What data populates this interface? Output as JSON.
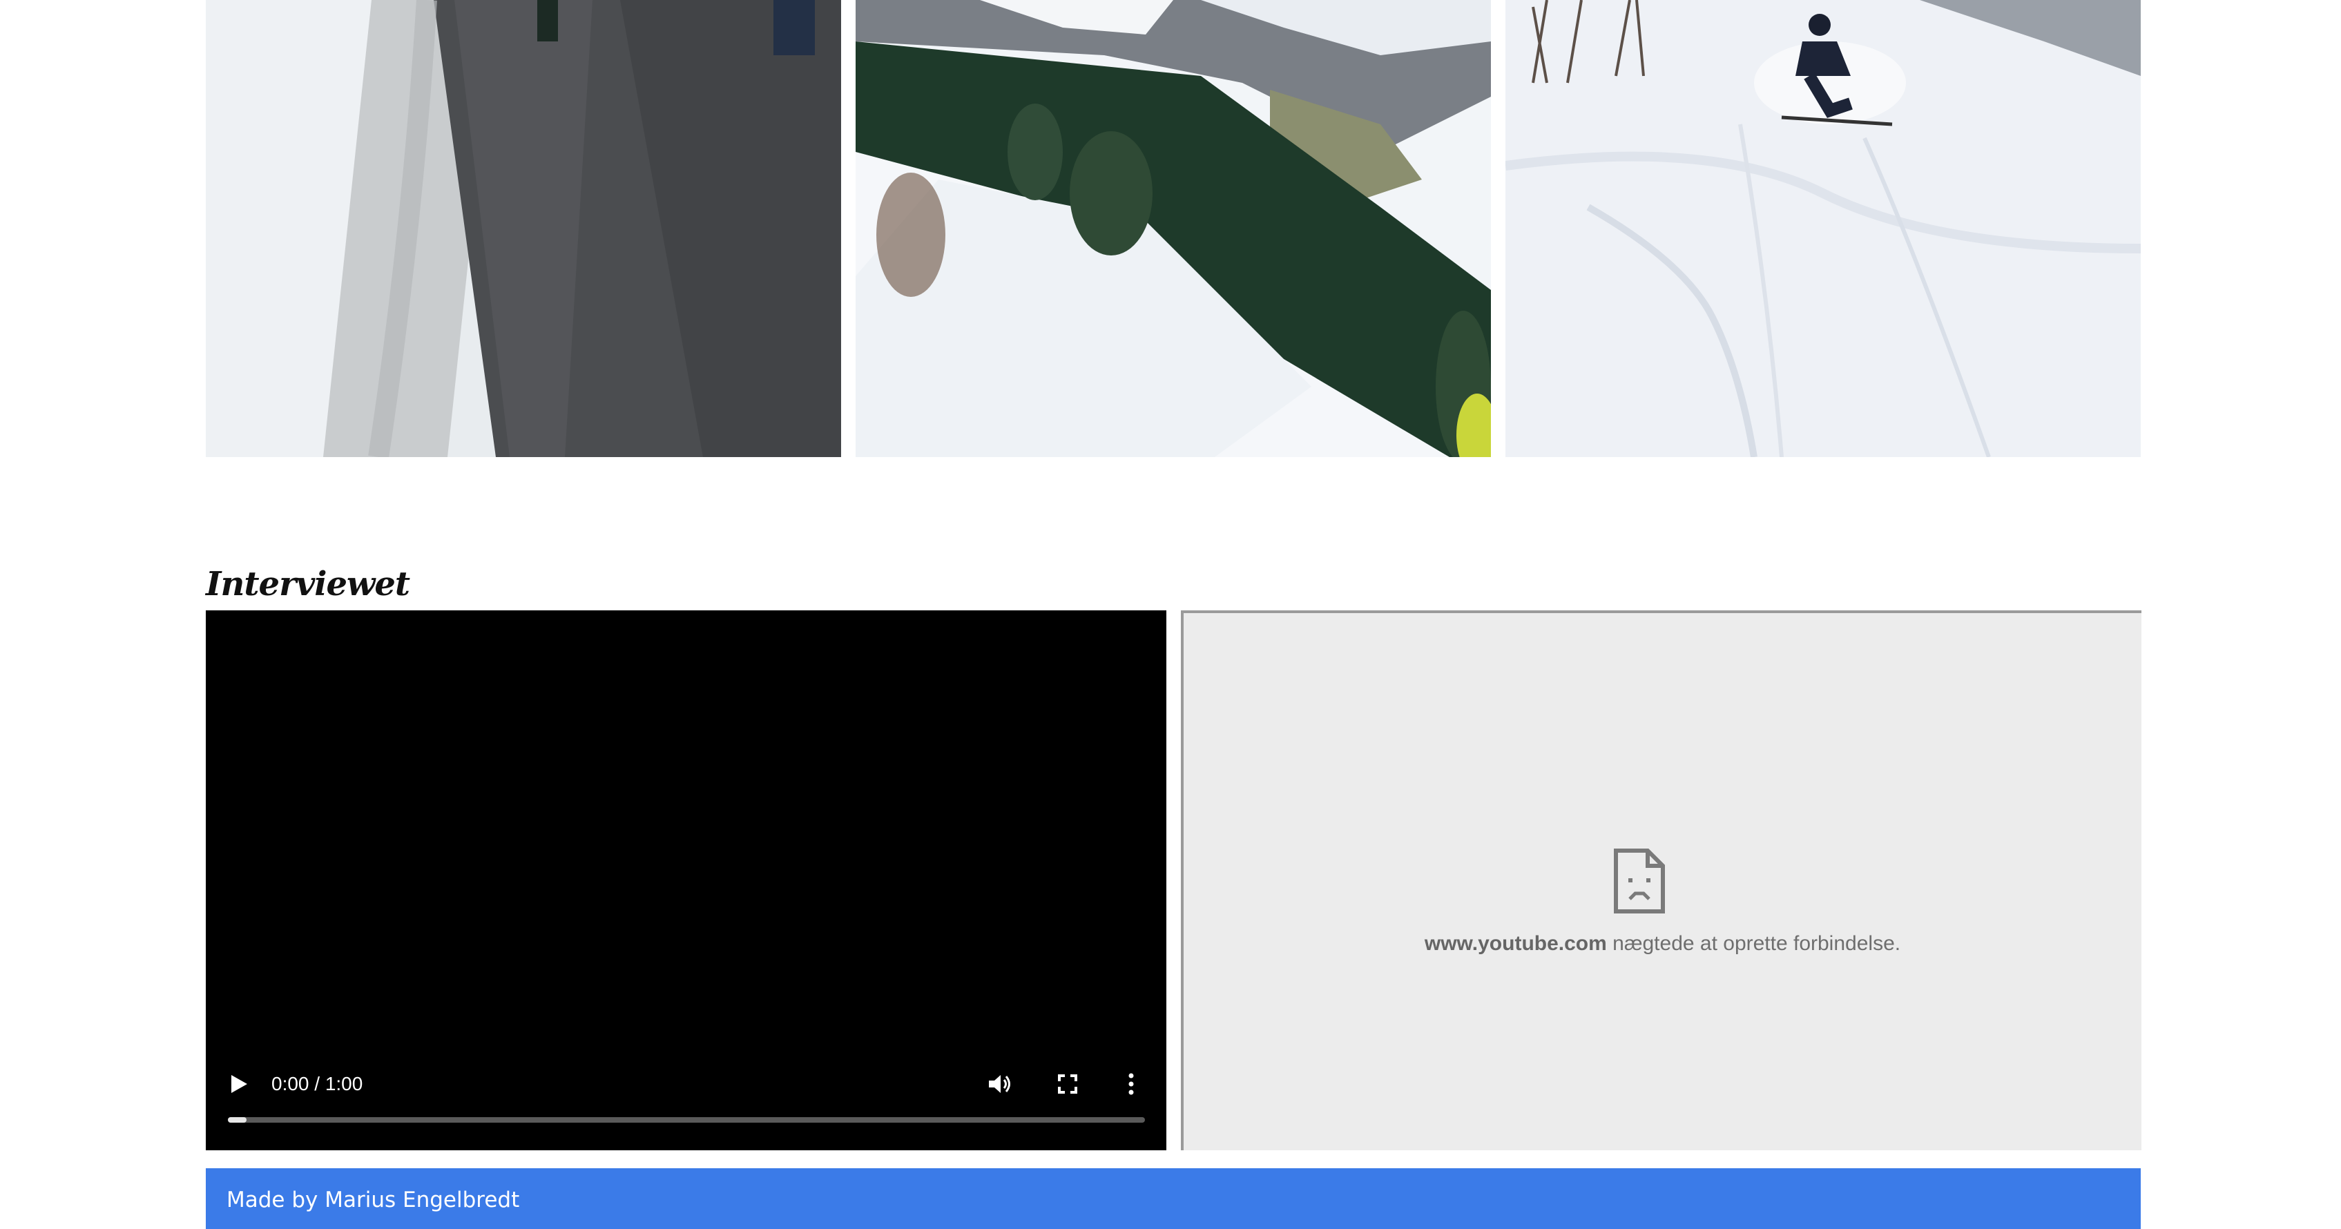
{
  "gallery": {
    "photos": [
      {
        "subject": "snowy road"
      },
      {
        "subject": "alpine valley"
      },
      {
        "subject": "powder skier"
      }
    ]
  },
  "section": {
    "title": "Interviewet"
  },
  "video": {
    "time": "0:00 / 1:00",
    "progress": 0.02,
    "icons": [
      "play-icon",
      "volume-icon",
      "fullscreen-icon",
      "more-options-icon"
    ]
  },
  "embed": {
    "host": "www.youtube.com",
    "message": " nægtede at oprette forbindelse.",
    "icon": "broken-document-icon"
  },
  "footer": {
    "text": "Made by Marius Engelbredt",
    "color": "#3b7be8"
  }
}
